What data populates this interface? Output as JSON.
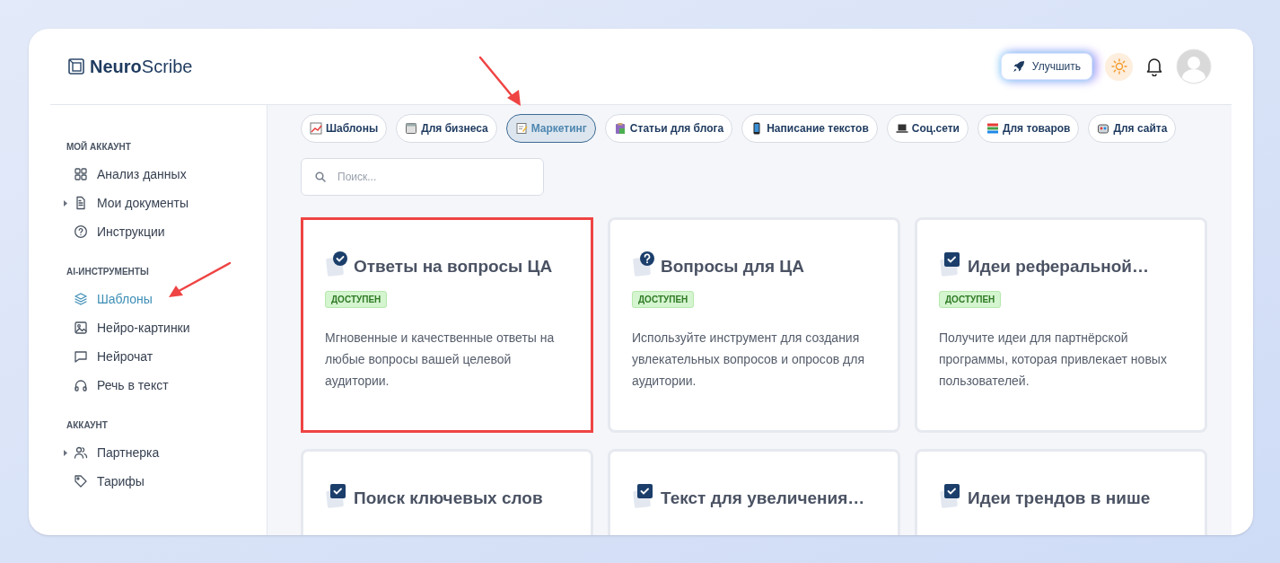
{
  "logo": {
    "bold": "Neuro",
    "light": "Scribe"
  },
  "header": {
    "upgrade_label": "Улучшить"
  },
  "sidebar": {
    "sections": [
      {
        "heading": "МОЙ АККАУНТ",
        "items": [
          {
            "label": "Анализ данных",
            "expandable": false,
            "selected": false,
            "pointed": false
          },
          {
            "label": "Мои документы",
            "expandable": true,
            "selected": false,
            "pointed": false
          },
          {
            "label": "Инструкции",
            "expandable": false,
            "selected": false,
            "pointed": false
          }
        ]
      },
      {
        "heading": "AI-ИНСТРУМЕНТЫ",
        "items": [
          {
            "label": "Шаблоны",
            "expandable": false,
            "selected": true,
            "pointed": true
          },
          {
            "label": "Нейро-картинки",
            "expandable": false,
            "selected": false,
            "pointed": false
          },
          {
            "label": "Нейрочат",
            "expandable": false,
            "selected": false,
            "pointed": false
          },
          {
            "label": "Речь в текст",
            "expandable": false,
            "selected": false,
            "pointed": false
          }
        ]
      },
      {
        "heading": "АККАУНТ",
        "items": [
          {
            "label": "Партнерка",
            "expandable": true,
            "selected": false,
            "pointed": false
          },
          {
            "label": "Тарифы",
            "expandable": false,
            "selected": false,
            "pointed": false
          }
        ]
      }
    ]
  },
  "categories": [
    {
      "label": "Шаблоны",
      "selected": false,
      "pointed": false
    },
    {
      "label": "Для бизнеса",
      "selected": false,
      "pointed": false
    },
    {
      "label": "Маркетинг",
      "selected": true,
      "pointed": true
    },
    {
      "label": "Статьи для блога",
      "selected": false,
      "pointed": false
    },
    {
      "label": "Написание текстов",
      "selected": false,
      "pointed": false
    },
    {
      "label": "Соц.сети",
      "selected": false,
      "pointed": false
    },
    {
      "label": "Для товаров",
      "selected": false,
      "pointed": false
    },
    {
      "label": "Для сайта",
      "selected": false,
      "pointed": false
    }
  ],
  "search": {
    "placeholder": "Поиск..."
  },
  "cards": [
    {
      "title": "Ответы на вопросы ЦА",
      "highlighted": true,
      "badge": "ДОСТУПЕН",
      "description": "Мгновенные и качественные ответы на любые вопросы вашей целевой аудитории."
    },
    {
      "title": "Вопросы для ЦА",
      "highlighted": false,
      "badge": "ДОСТУПЕН",
      "description": "Используйте инструмент для создания увлекательных вопросов и опросов для аудитории."
    },
    {
      "title": "Идеи реферальной…",
      "highlighted": false,
      "badge": "ДОСТУПЕН",
      "description": "Получите идеи для партнёрской программы, которая привлекает новых пользователей."
    },
    {
      "title": "Поиск ключевых слов",
      "highlighted": false
    },
    {
      "title": "Текст для увеличения…",
      "highlighted": false
    },
    {
      "title": "Идеи трендов в нише",
      "highlighted": false
    }
  ]
}
